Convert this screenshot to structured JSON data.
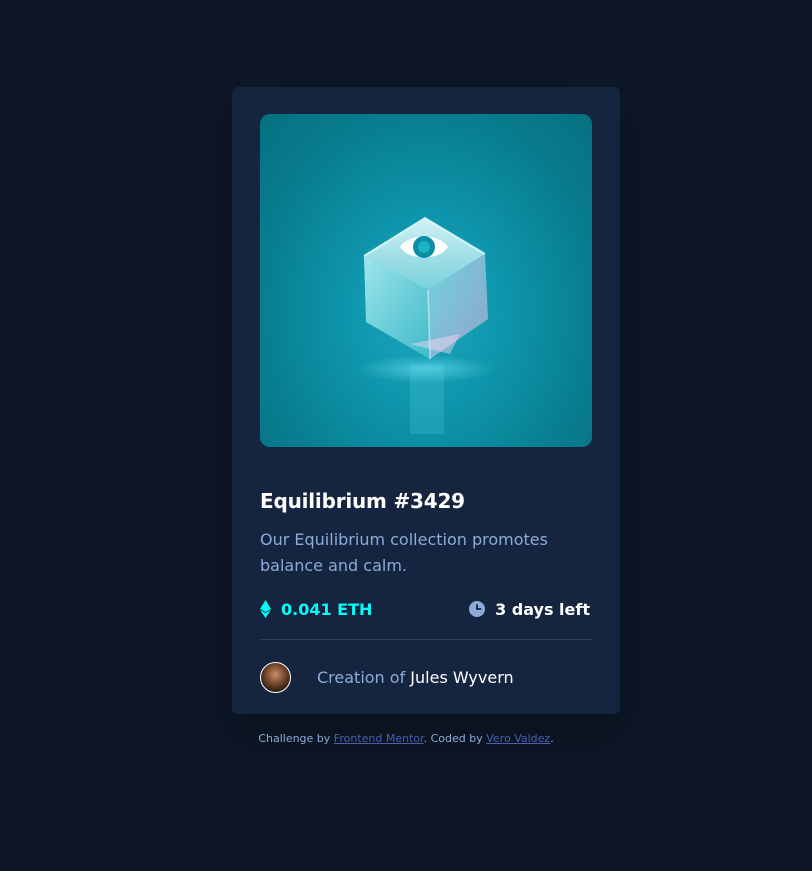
{
  "card": {
    "title": "Equilibrium #3429",
    "description": "Our Equilibrium collection promotes balance and calm.",
    "price": "0.041 ETH",
    "time_left": "3 days left",
    "creator_prefix": "Creation of",
    "creator_name": "Jules Wyvern"
  },
  "icons": {
    "view": "eye-icon",
    "price": "ethereum-icon",
    "time": "clock-icon"
  },
  "attribution": {
    "prefix": "Challenge by",
    "link1": "Frontend Mentor",
    "middle": ". Coded by",
    "link2": "Vero Valdez",
    "suffix": "."
  },
  "colors": {
    "page_bg": "#0d1726",
    "card_bg": "#15253f",
    "accent_cyan": "#00fff8",
    "soft_blue": "#8bacd9",
    "link": "#4a5fb0"
  }
}
